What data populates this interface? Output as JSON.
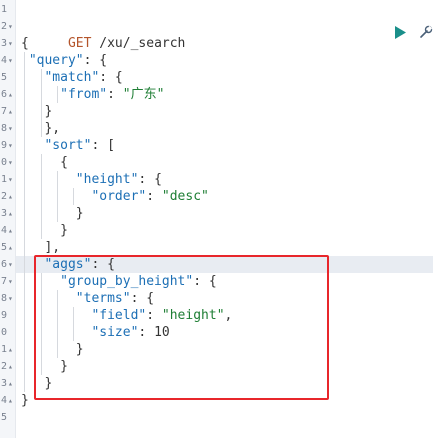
{
  "colors": {
    "method": "#b4552b",
    "key": "#1c6fb5",
    "string": "#1e7e34",
    "highlight_border": "#e8262b",
    "run_icon": "#1a8f8a"
  },
  "toolbar": {
    "run_icon": "play-icon",
    "settings_icon": "wrench-icon"
  },
  "gutter": [
    {
      "num": "1",
      "fold": ""
    },
    {
      "num": "2",
      "fold": "▾"
    },
    {
      "num": "3",
      "fold": "▾"
    },
    {
      "num": "4",
      "fold": "▾"
    },
    {
      "num": "5",
      "fold": ""
    },
    {
      "num": "6",
      "fold": "▴"
    },
    {
      "num": "7",
      "fold": "▴"
    },
    {
      "num": "8",
      "fold": "▾"
    },
    {
      "num": "9",
      "fold": "▾"
    },
    {
      "num": "0",
      "fold": "▾"
    },
    {
      "num": "1",
      "fold": "▾"
    },
    {
      "num": "2",
      "fold": "▴"
    },
    {
      "num": "3",
      "fold": "▴"
    },
    {
      "num": "4",
      "fold": "▴"
    },
    {
      "num": "5",
      "fold": "▴"
    },
    {
      "num": "6",
      "fold": "▾"
    },
    {
      "num": "7",
      "fold": "▾"
    },
    {
      "num": "8",
      "fold": "▾"
    },
    {
      "num": "9",
      "fold": ""
    },
    {
      "num": "0",
      "fold": ""
    },
    {
      "num": "1",
      "fold": "▴"
    },
    {
      "num": "2",
      "fold": "▴"
    },
    {
      "num": "3",
      "fold": "▴"
    },
    {
      "num": "4",
      "fold": "▴"
    },
    {
      "num": "5",
      "fold": ""
    }
  ],
  "request": {
    "method": "GET",
    "path": " /xu/_search"
  },
  "lines": [
    {
      "indent": "",
      "tokens": [
        [
          "p",
          "{"
        ]
      ]
    },
    {
      "indent": " ",
      "tokens": [
        [
          "k",
          "\"query\""
        ],
        [
          "p",
          ": {"
        ]
      ]
    },
    {
      "indent": "   ",
      "tokens": [
        [
          "k",
          "\"match\""
        ],
        [
          "p",
          ": {"
        ]
      ]
    },
    {
      "indent": "     ",
      "tokens": [
        [
          "k",
          "\"from\""
        ],
        [
          "p",
          ": "
        ],
        [
          "s",
          "\"广东\""
        ]
      ]
    },
    {
      "indent": "   ",
      "tokens": [
        [
          "p",
          "}"
        ]
      ]
    },
    {
      "indent": "   ",
      "tokens": [
        [
          "p",
          "},"
        ]
      ]
    },
    {
      "indent": "   ",
      "tokens": [
        [
          "k",
          "\"sort\""
        ],
        [
          "p",
          ": ["
        ]
      ]
    },
    {
      "indent": "     ",
      "tokens": [
        [
          "p",
          "{"
        ]
      ]
    },
    {
      "indent": "       ",
      "tokens": [
        [
          "k",
          "\"height\""
        ],
        [
          "p",
          ": {"
        ]
      ]
    },
    {
      "indent": "         ",
      "tokens": [
        [
          "k",
          "\"order\""
        ],
        [
          "p",
          ": "
        ],
        [
          "s",
          "\"desc\""
        ]
      ]
    },
    {
      "indent": "       ",
      "tokens": [
        [
          "p",
          "}"
        ]
      ]
    },
    {
      "indent": "     ",
      "tokens": [
        [
          "p",
          "}"
        ]
      ]
    },
    {
      "indent": "   ",
      "tokens": [
        [
          "p",
          "],"
        ]
      ]
    },
    {
      "indent": "   ",
      "tokens": [
        [
          "k",
          "\"aggs\""
        ],
        [
          "p",
          ": {"
        ]
      ],
      "active": true
    },
    {
      "indent": "     ",
      "tokens": [
        [
          "k",
          "\"group_by_height\""
        ],
        [
          "p",
          ": {"
        ]
      ]
    },
    {
      "indent": "       ",
      "tokens": [
        [
          "k",
          "\"terms\""
        ],
        [
          "p",
          ": {"
        ]
      ]
    },
    {
      "indent": "         ",
      "tokens": [
        [
          "k",
          "\"field\""
        ],
        [
          "p",
          ": "
        ],
        [
          "s",
          "\"height\""
        ],
        [
          "p",
          ","
        ]
      ]
    },
    {
      "indent": "         ",
      "tokens": [
        [
          "k",
          "\"size\""
        ],
        [
          "p",
          ": "
        ],
        [
          "n",
          "10"
        ]
      ]
    },
    {
      "indent": "       ",
      "tokens": [
        [
          "p",
          "}"
        ]
      ]
    },
    {
      "indent": "     ",
      "tokens": [
        [
          "p",
          "}"
        ]
      ]
    },
    {
      "indent": "   ",
      "tokens": [
        [
          "p",
          "}"
        ]
      ]
    },
    {
      "indent": "",
      "tokens": [
        [
          "p",
          "}"
        ]
      ]
    }
  ]
}
